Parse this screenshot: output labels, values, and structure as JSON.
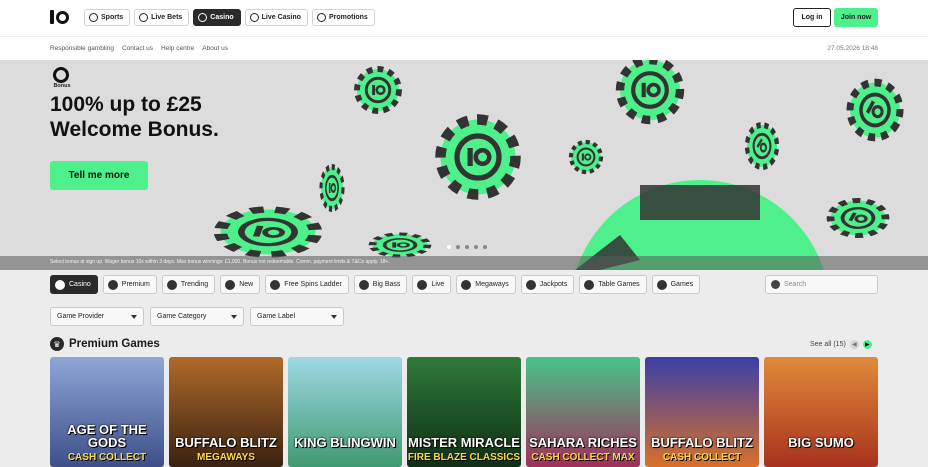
{
  "nav": {
    "tabs": [
      {
        "label": "Sports",
        "icon": "sports-icon"
      },
      {
        "label": "Live Bets",
        "icon": "live-bets-icon"
      },
      {
        "label": "Casino",
        "icon": "casino-icon",
        "active": true
      },
      {
        "label": "Live Casino",
        "icon": "live-casino-icon"
      },
      {
        "label": "Promotions",
        "icon": "promotions-icon"
      }
    ],
    "login_label": "Log in",
    "join_label": "Join now"
  },
  "subnav": {
    "links": [
      "Responsible gambling",
      "Contact us",
      "Help centre",
      "About us"
    ],
    "datetime": "27.05.2026 18:48"
  },
  "hero": {
    "badge": "Bonus",
    "title": "100% up to £25 Welcome Bonus.",
    "cta": "Tell me more",
    "terms": "Select bonus at sign up. Wager bonus 10x within 3 days. Max bonus winnings: £1,000. Bonus not redeemable. Comm. payment limits & T&Cs apply. 18+.",
    "active_slide": 1,
    "slide_count": 5
  },
  "categories": [
    {
      "label": "Casino",
      "icon": "casino-icon",
      "active": true
    },
    {
      "label": "Premium",
      "icon": "premium-icon"
    },
    {
      "label": "Trending",
      "icon": "trending-icon"
    },
    {
      "label": "New",
      "icon": "new-icon"
    },
    {
      "label": "Free Spins Ladder",
      "icon": "ladder-icon"
    },
    {
      "label": "Big Bass",
      "icon": "fish-icon"
    },
    {
      "label": "Live",
      "icon": "live-icon"
    },
    {
      "label": "Megaways",
      "icon": "megaways-icon"
    },
    {
      "label": "Jackpots",
      "icon": "jackpot-icon"
    },
    {
      "label": "Table Games",
      "icon": "table-games-icon"
    },
    {
      "label": "Games",
      "icon": "games-icon"
    }
  ],
  "search": {
    "placeholder": "Search"
  },
  "filters": [
    "Game Provider",
    "Game Category",
    "Game Label"
  ],
  "premium": {
    "title": "Premium Games",
    "see_all": "See all (15)",
    "games": [
      {
        "title": "AGE OF THE GODS",
        "subtitle": "CASH COLLECT",
        "bg": "#6b7fb0"
      },
      {
        "title": "BUFFALO BLITZ",
        "subtitle": "MEGAWAYS",
        "bg": "#6a3f23"
      },
      {
        "title": "KING BLINGWIN",
        "subtitle": "",
        "bg": "#5fa5b8"
      },
      {
        "title": "MISTER MIRACLE",
        "subtitle": "FIRE BLAZE CLASSICS",
        "bg": "#1e5a2a"
      },
      {
        "title": "SAHARA RICHES",
        "subtitle": "CASH COLLECT MAX",
        "bg": "#2fa06a"
      },
      {
        "title": "BUFFALO BLITZ",
        "subtitle": "CASH COLLECT",
        "bg": "#2b2f7a"
      },
      {
        "title": "BIG SUMO",
        "subtitle": "",
        "bg": "#c24a2a"
      }
    ]
  },
  "colors": {
    "accent": "#4df08a",
    "dark": "#2a2a2a"
  }
}
